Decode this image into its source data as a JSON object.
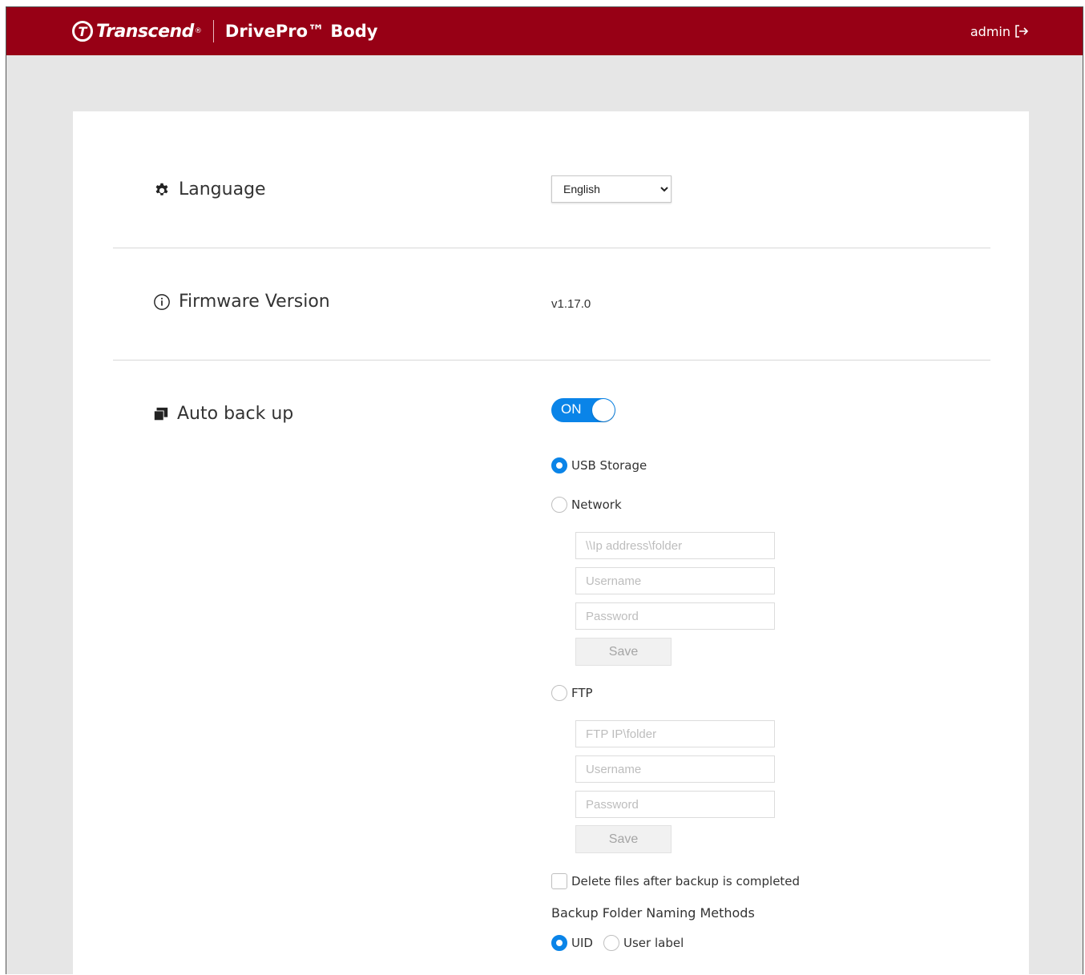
{
  "header": {
    "brand": "Transcend",
    "brand_mark": "T",
    "registered": "®",
    "product": "DrivePro™ Body",
    "user": "admin",
    "logout_icon": "logout-icon",
    "background": "#970015"
  },
  "language": {
    "label": "Language",
    "icon": "gear-icon",
    "selected": "English"
  },
  "firmware": {
    "label": "Firmware Version",
    "icon": "info-icon",
    "value": "v1.17.0"
  },
  "auto_backup": {
    "label": "Auto back up",
    "icon": "copy-icon",
    "toggle_label": "ON",
    "toggle_on": true,
    "accent": "#0a84e8",
    "usb_label": "USB Storage",
    "network_label": "Network",
    "network": {
      "address_placeholder": "\\\\Ip address\\folder",
      "username_placeholder": "Username",
      "password_placeholder": "Password",
      "save_label": "Save"
    },
    "ftp_label": "FTP",
    "ftp": {
      "address_placeholder": "FTP IP\\folder",
      "username_placeholder": "Username",
      "password_placeholder": "Password",
      "save_label": "Save"
    },
    "delete_label": "Delete files after backup is completed",
    "naming_title": "Backup Folder Naming Methods",
    "naming_uid": "UID",
    "naming_user_label": "User label"
  }
}
